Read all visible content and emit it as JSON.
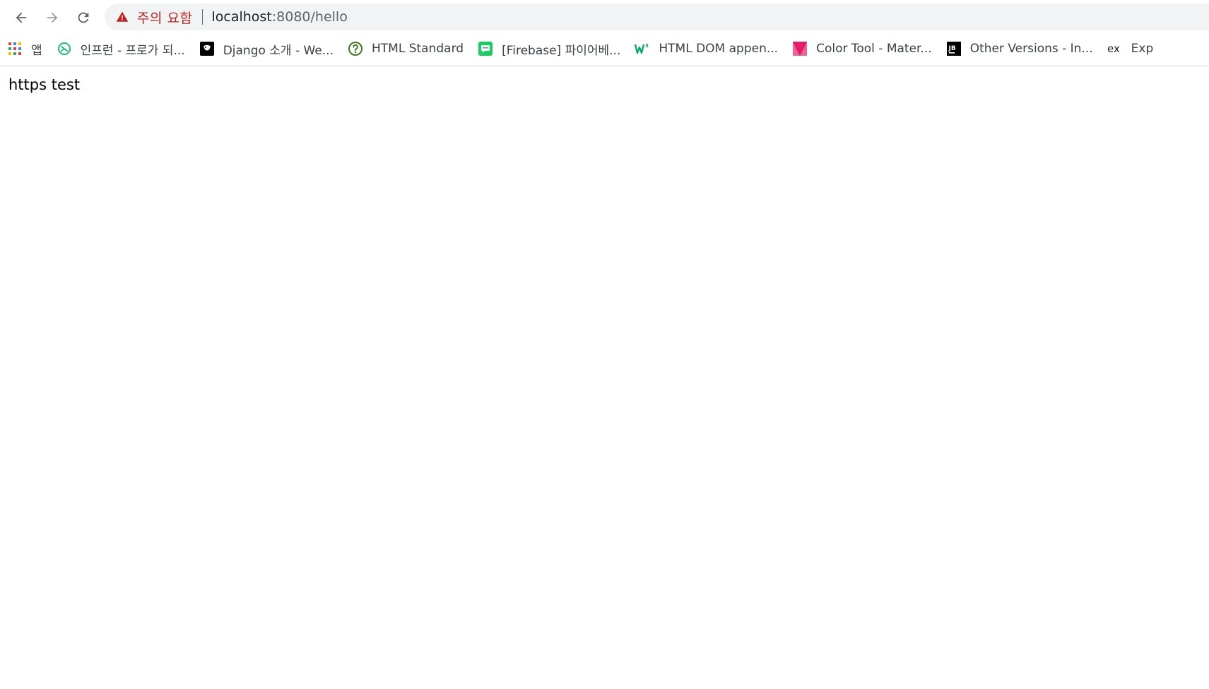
{
  "toolbar": {
    "back_icon": "arrow-left-icon",
    "forward_icon": "arrow-right-icon",
    "reload_icon": "reload-icon"
  },
  "omnibox": {
    "security_label": "주의 요함",
    "url_host": "localhost",
    "url_path": ":8080/hello",
    "warning_color": "#c5221f"
  },
  "bookmarks": [
    {
      "label": "앱",
      "icon": "apps-grid-icon"
    },
    {
      "label": "인프런 - 프로가 되...",
      "icon": "inflearn-icon"
    },
    {
      "label": "Django 소개 - We...",
      "icon": "django-icon"
    },
    {
      "label": "HTML Standard",
      "icon": "help-circle-icon"
    },
    {
      "label": "[Firebase] 파이어베...",
      "icon": "chat-bubble-icon"
    },
    {
      "label": "HTML DOM appen...",
      "icon": "w3schools-icon"
    },
    {
      "label": "Color Tool - Mater...",
      "icon": "material-color-icon"
    },
    {
      "label": "Other Versions - In...",
      "icon": "jetbrains-icon"
    },
    {
      "label": "Exp",
      "icon": "ex-icon"
    }
  ],
  "page": {
    "body_text": "https test"
  }
}
